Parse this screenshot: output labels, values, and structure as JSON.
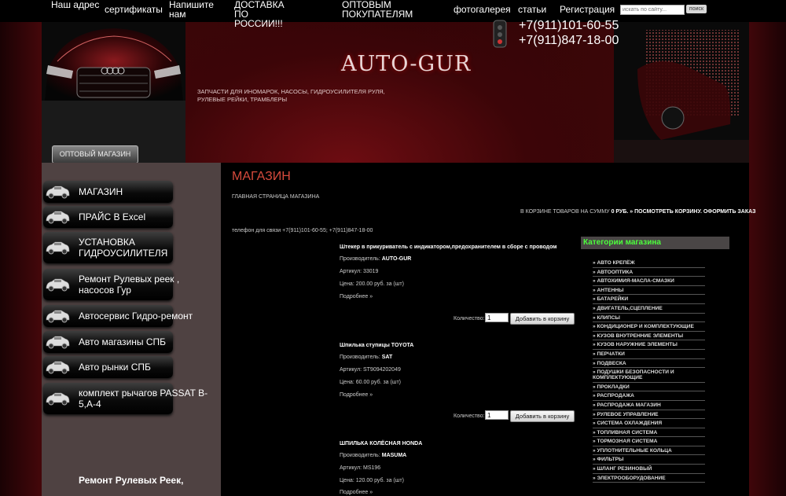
{
  "nav": {
    "items": [
      "Наш адрес",
      "сертификаты",
      "Напишите нам",
      "ДОСТАВКА ПО РОССИИ!!!",
      "ОПТОВЫМ ПОКУПАТЕЛЯМ",
      "фотогалерея",
      "статьи",
      "Регистрация"
    ],
    "search_placeholder": "искать по сайту...",
    "search_button": "поиск"
  },
  "header": {
    "logo": "AUTO-GUR",
    "tagline": "ЗАПЧАСТИ ДЛЯ ИНОМАРОК, НАСОСЫ, ГИДРОУСИЛИТЕЛЯ РУЛЯ, РУЛЕВЫЕ РЕЙКИ, ТРАМБЛЕРЫ",
    "phone1": "+7(911)101-60-55",
    "phone2": "+7(911)847-18-00",
    "wholesale_button": "ОПТОВЫЙ МАГАЗИН"
  },
  "sidebar": {
    "items": [
      "МАГАЗИН",
      "ПРАЙС В Excel",
      "УСТАНОВКА ГИДРОУСИЛИТЕЛЯ",
      "Ремонт Рулевых реек , насосов Гур",
      "Автосервис Гидро-ремонт",
      "Авто магазины СПБ",
      "Авто рынки СПБ",
      "комплект рычагов PASSAT B-5,А-4"
    ],
    "bottom_text": "Ремонт Рулевых Реек,"
  },
  "main": {
    "title": "МАГАЗИН",
    "breadcrumb": "ГЛАВНАЯ СТРАНИЦА МАГАЗИНА",
    "cart_prefix": "В КОРЗИНЕ ТОВАРОВ НА СУММУ",
    "cart_sum": "0 РУБ.",
    "cart_view": "» ПОСМОТРЕТЬ КОРЗИНУ.",
    "cart_order": "ОФОРМИТЬ ЗАКАЗ",
    "contact": "телефон для связи +7(911)101-60-55; +7(911)847-18-00",
    "qty_label": "Количество:",
    "add_label": "Добавить в корзину",
    "products": [
      {
        "title": "Штекер в прикуриватель с индикатором,предохранителем в сборе с проводом",
        "maker_label": "Производитель:",
        "maker": "AUTO-GUR",
        "sku": "Артикул: 33019",
        "price": "Цена: 200.00 руб. за (шт)",
        "more": "Подробнее »",
        "qty": "1"
      },
      {
        "title": "Шпилька ступицы TOYOTA",
        "maker_label": "Производитель:",
        "maker": "SAT",
        "sku": "Артикул: ST9094202049",
        "price": "Цена: 60.00 руб. за (шт)",
        "more": "Подробнее »",
        "qty": "1"
      },
      {
        "title": "ШПИЛЬКА КОЛЁСНАЯ HONDA",
        "maker_label": "Производитель:",
        "maker": "MASUMA",
        "sku": "Артикул: MS196",
        "price": "Цена: 120.00 руб. за (шт)",
        "more": "Подробнее »"
      }
    ]
  },
  "categories": {
    "title": "Категории магазина",
    "items": [
      "» АВТО КРЕПЁЖ",
      "» АВТООПТИКА",
      "» АВТОХИМИЯ-МАСЛА-СМАЗКИ",
      "» АНТЕННЫ",
      "» БАТАРЕЙКИ",
      "» ДВИГАТЕЛЬ,СЦЕПЛЕНИЕ",
      "» КЛИПСЫ",
      "» КОНДИЦИОНЕР И КОМПЛЕКТУЮЩИЕ",
      "» КУЗОВ ВНУТРЕННИЕ ЭЛЕМЕНТЫ",
      "» КУЗОВ НАРУЖНИЕ ЭЛЕМЕНТЫ",
      "» ПЕРЧАТКИ",
      "» ПОДВЕСКА",
      "» ПОДУШКИ БЕЗОПАСНОСТИ И КОМПЛЕКТУЮЩИЕ",
      "» ПРОКЛАДКИ",
      "» РАСПРОДАЖА",
      "» РАСПРОДАЖА МАГАЗИН",
      "» РУЛЕВОЕ УПРАВЛЕНИЕ",
      "» СИСТЕМА ОХЛАЖДЕНИЯ",
      "» ТОПЛИВНАЯ СИСТЕМА",
      "» ТОРМОЗНАЯ СИСТЕМА",
      "» УПЛОТНИТЕЛЬНЫЕ КОЛЬЦА",
      "» ФИЛЬТРЫ",
      "» ШЛАНГ РЕЗИНОВЫЙ",
      "» ЭЛЕКТРООБОРУДОВАНИЕ"
    ]
  }
}
